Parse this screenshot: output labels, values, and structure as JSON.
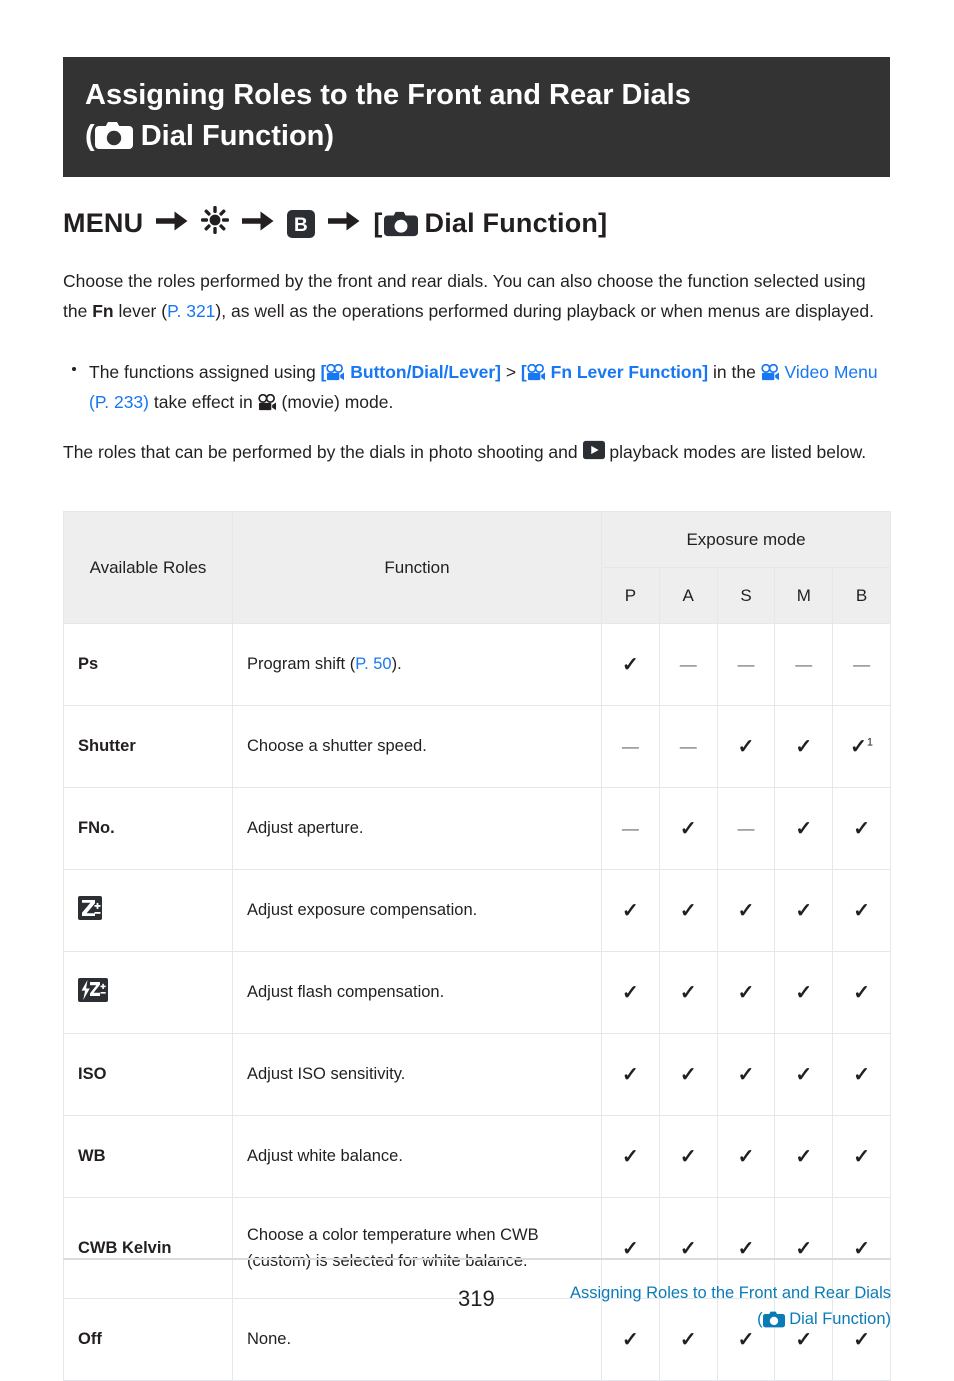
{
  "title": {
    "line1": "Assigning Roles to the Front and Rear Dials",
    "line2_open": "(",
    "line2_text": "Dial Function)",
    "icon": "camera-icon"
  },
  "menu_path": {
    "menu_label": "MENU",
    "arrow": "→",
    "gear_icon": "gear-icon",
    "b_icon": "b-button-icon",
    "camera_icon": "camera-icon",
    "target_open": "[",
    "target_label": "Dial Function]"
  },
  "intro": {
    "p1_part1": "Choose the roles performed by the front and rear dials. You can also choose the function selected using the ",
    "p1_fn": "Fn",
    "p1_part2": " lever (",
    "p1_link": "P. 321",
    "p1_part3": "), as well as the operations performed during playback or when menus are displayed."
  },
  "bullet": {
    "text1": "The functions assigned using ",
    "link1_open": "[",
    "link1_label": "Button/Dial/Lever]",
    "sep": " > ",
    "link2_open": "[",
    "link2_label": "Fn Lever Function]",
    "text2": " in the ",
    "link3_label": "Video Menu (P. 233)",
    "text3": " take effect in ",
    "text4": " (movie) mode."
  },
  "intro2": {
    "part1": "The roles that can be performed by the dials in photo shooting and ",
    "playback_icon": "playback-icon",
    "part2": " playback modes are listed below."
  },
  "table": {
    "headers": {
      "roles": "Available Roles",
      "function": "Function",
      "exposure": "Exposure mode",
      "modes": [
        "P",
        "A",
        "S",
        "M",
        "B"
      ]
    },
    "rows": [
      {
        "role": "Ps",
        "role_icon": null,
        "func_pre": "Program shift (",
        "func_link": "P. 50",
        "func_post": ").",
        "marks": [
          "✓",
          "—",
          "—",
          "—",
          "—"
        ],
        "footnote_on": -1
      },
      {
        "role": "Shutter",
        "role_icon": null,
        "func_pre": "Choose a shutter speed.",
        "func_link": null,
        "func_post": "",
        "marks": [
          "—",
          "—",
          "✓",
          "✓",
          "✓"
        ],
        "footnote_on": 4,
        "footnote_mark": "1"
      },
      {
        "role": "FNo.",
        "role_icon": null,
        "func_pre": "Adjust aperture.",
        "func_link": null,
        "func_post": "",
        "marks": [
          "—",
          "✓",
          "—",
          "✓",
          "✓"
        ],
        "footnote_on": -1
      },
      {
        "role": "",
        "role_icon": "exposure-compensation-icon",
        "func_pre": "Adjust exposure compensation.",
        "func_link": null,
        "func_post": "",
        "marks": [
          "✓",
          "✓",
          "✓",
          "✓",
          "✓"
        ],
        "footnote_on": -1
      },
      {
        "role": "",
        "role_icon": "flash-compensation-icon",
        "func_pre": "Adjust flash compensation.",
        "func_link": null,
        "func_post": "",
        "marks": [
          "✓",
          "✓",
          "✓",
          "✓",
          "✓"
        ],
        "footnote_on": -1
      },
      {
        "role": "ISO",
        "role_icon": null,
        "func_pre": "Adjust ISO sensitivity.",
        "func_link": null,
        "func_post": "",
        "marks": [
          "✓",
          "✓",
          "✓",
          "✓",
          "✓"
        ],
        "footnote_on": -1
      },
      {
        "role": "WB",
        "role_icon": null,
        "func_pre": "Adjust white balance.",
        "func_link": null,
        "func_post": "",
        "marks": [
          "✓",
          "✓",
          "✓",
          "✓",
          "✓"
        ],
        "footnote_on": -1
      },
      {
        "role": "CWB Kelvin",
        "role_icon": null,
        "func_pre": "Choose a color temperature when CWB (custom) is selected for white balance.",
        "func_link": null,
        "func_post": "",
        "marks": [
          "✓",
          "✓",
          "✓",
          "✓",
          "✓"
        ],
        "footnote_on": -1,
        "tall": true
      },
      {
        "role": "Off",
        "role_icon": null,
        "func_pre": "None.",
        "func_link": null,
        "func_post": "",
        "marks": [
          "✓",
          "✓",
          "✓",
          "✓",
          "✓"
        ],
        "footnote_on": -1
      }
    ]
  },
  "footer": {
    "page_number": "319",
    "link_line1": "Assigning Roles to the Front and Rear Dials",
    "link_line2_open": "(",
    "link_line2_text": "Dial Function)"
  },
  "colors": {
    "title_bar_bg": "#333333",
    "link_blue": "#1877f2",
    "footer_blue": "#0b7bb5",
    "table_header_bg": "#eeeeee",
    "table_border": "#e3e8ee",
    "text": "#231f20"
  }
}
